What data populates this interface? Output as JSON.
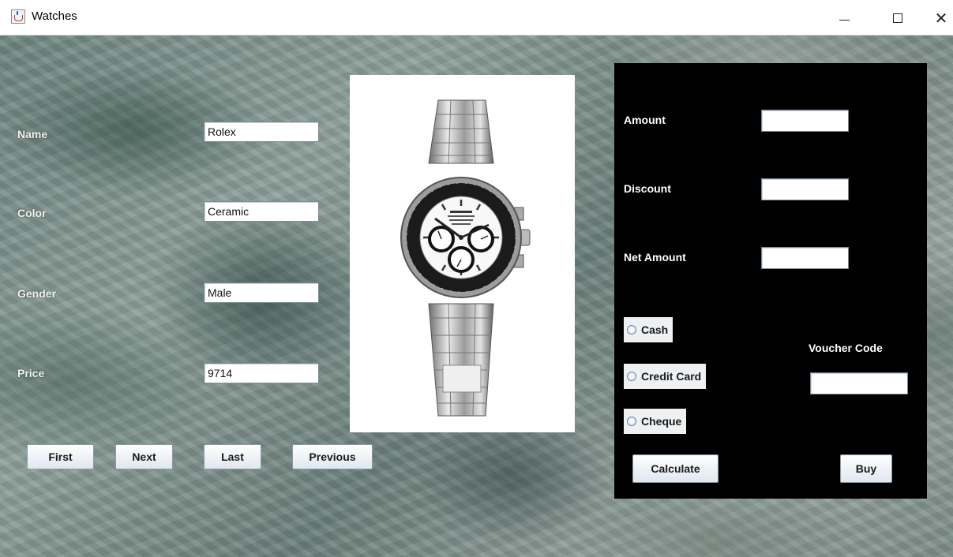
{
  "window": {
    "title": "Watches",
    "icon": "java-cup-icon",
    "controls": {
      "minimize": "minimize-icon",
      "maximize": "maximize-icon",
      "close": "close-icon"
    }
  },
  "form": {
    "name_label": "Name",
    "name_value": "Rolex",
    "color_label": "Color",
    "color_value": "Ceramic",
    "gender_label": "Gender",
    "gender_value": "Male",
    "price_label": "Price",
    "price_value": "9714"
  },
  "nav": {
    "first": "First",
    "next": "Next",
    "last": "Last",
    "previous": "Previous"
  },
  "payment": {
    "amount_label": "Amount",
    "amount_value": "",
    "discount_label": "Discount",
    "discount_value": "",
    "net_amount_label": "Net Amount",
    "net_amount_value": "",
    "voucher_label": "Voucher Code",
    "voucher_value": "",
    "methods": [
      "Cash",
      "Credit Card",
      "Cheque"
    ],
    "calculate": "Calculate",
    "buy": "Buy"
  },
  "colors": {
    "panel_bg": "#000000",
    "label_text": "#ffffff",
    "button_gradient_top": "#ffffff",
    "button_gradient_bottom": "#dfe7ef"
  }
}
